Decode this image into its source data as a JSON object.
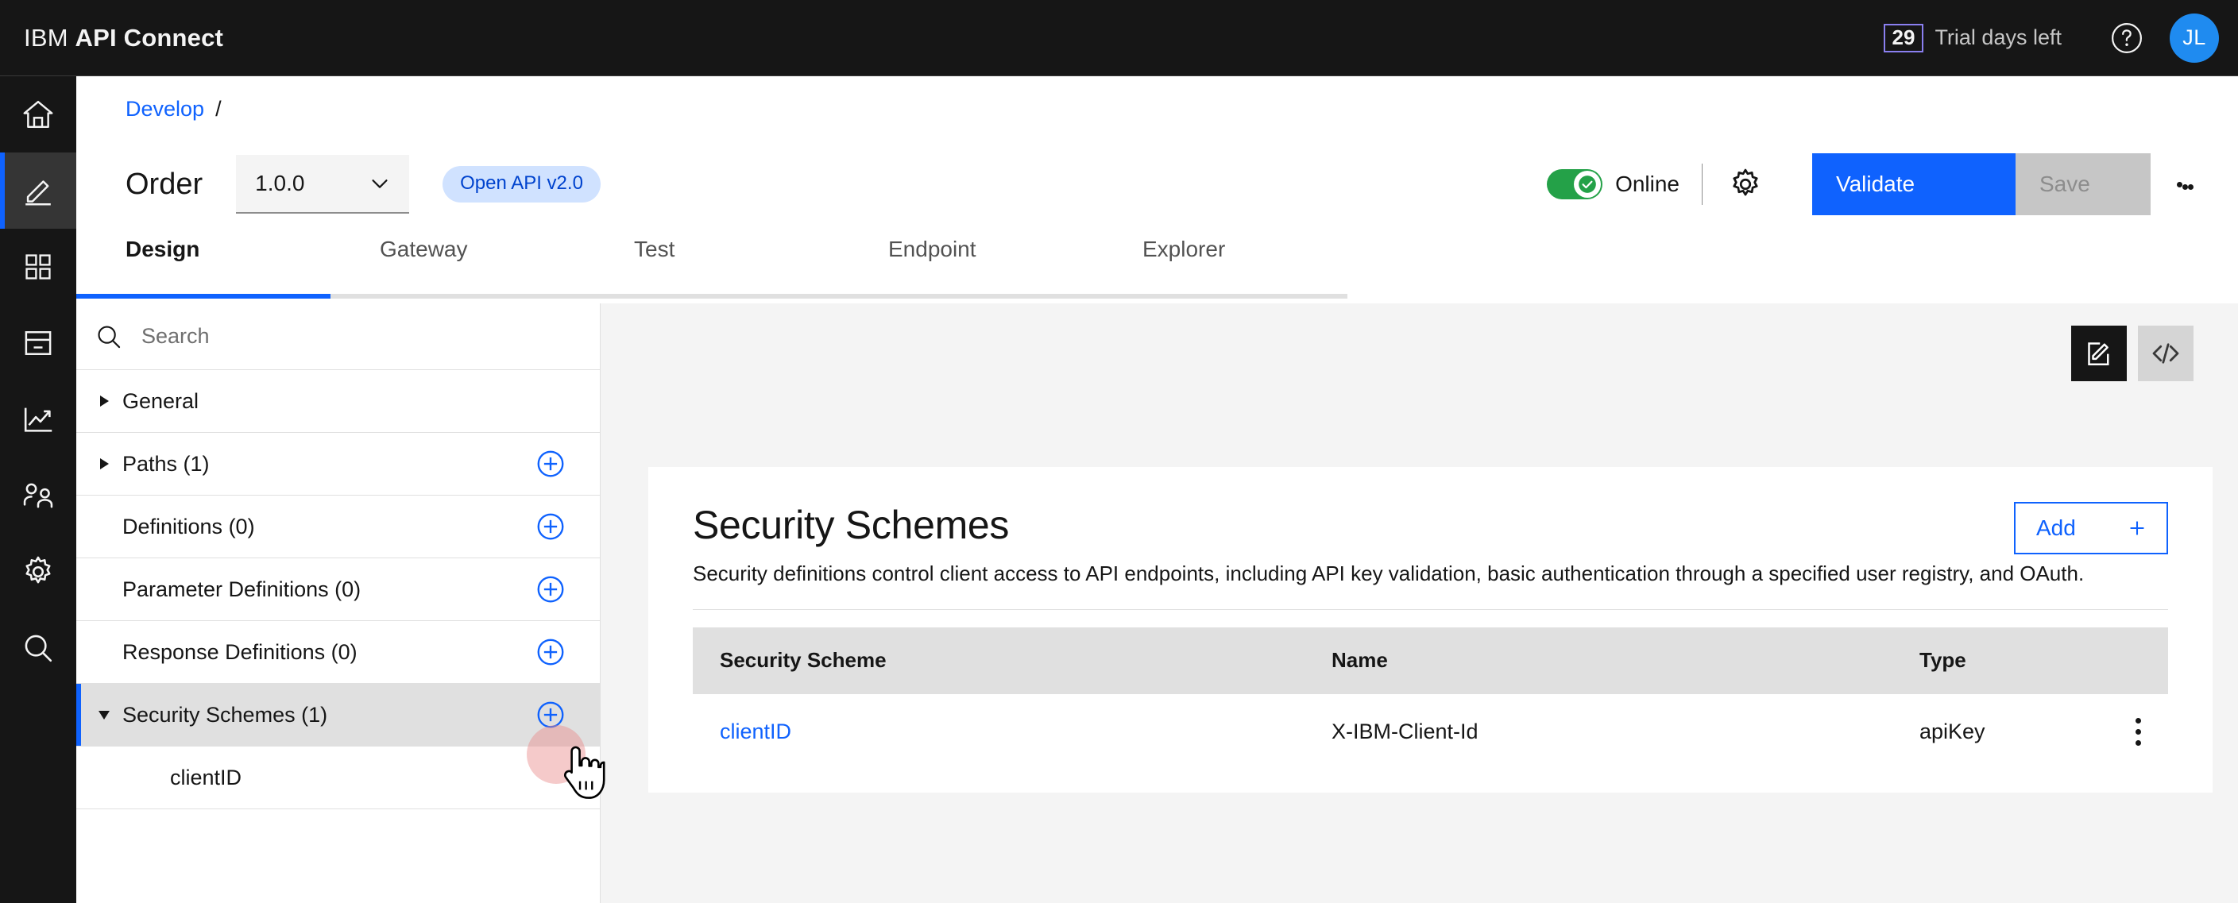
{
  "header": {
    "brand_prefix": "IBM",
    "brand_product": "API Connect",
    "trial_days": "29",
    "trial_label": "Trial days left",
    "help_icon": "help-circle-icon",
    "avatar_initials": "JL",
    "avatar_color": "#1f8bf0",
    "badge_border_color": "#8a7ff0",
    "background": "#161616"
  },
  "rail": {
    "items": [
      {
        "icon": "home-icon",
        "name": "home",
        "active": false
      },
      {
        "icon": "pencil-edit-icon",
        "name": "develop",
        "active": true
      },
      {
        "icon": "grid-apps-icon",
        "name": "manage",
        "active": false
      },
      {
        "icon": "catalog-icon",
        "name": "catalog",
        "active": false
      },
      {
        "icon": "analytics-chart-icon",
        "name": "analytics",
        "active": false
      },
      {
        "icon": "users-icon",
        "name": "members",
        "active": false
      },
      {
        "icon": "gear-icon",
        "name": "settings",
        "active": false
      },
      {
        "icon": "search-icon",
        "name": "search",
        "active": false
      }
    ],
    "active_indicator_color": "#0f62fe"
  },
  "breadcrumb": {
    "link": "Develop",
    "separator": "/"
  },
  "api_bar": {
    "name": "Order",
    "version_selected": "1.0.0",
    "version_caret_icon": "chevron-down-icon",
    "spec_tag": "Open API v2.0",
    "spec_tag_bg": "#d0e2ff",
    "spec_tag_color": "#0043ce",
    "online_label": "Online",
    "online_enabled": true,
    "toggle_color": "#24a148",
    "settings_icon": "gear-icon",
    "validate_label": "Validate",
    "validate_color": "#0f62fe",
    "save_label": "Save",
    "save_disabled": true,
    "overflow_icon": "kebab-menu-icon"
  },
  "tabs": [
    {
      "label": "Design",
      "active": true
    },
    {
      "label": "Gateway",
      "active": false
    },
    {
      "label": "Test",
      "active": false
    },
    {
      "label": "Endpoint",
      "active": false
    },
    {
      "label": "Explorer",
      "active": false
    }
  ],
  "tree": {
    "search_placeholder": "Search",
    "search_value": "",
    "search_icon": "search-icon",
    "rows": [
      {
        "label": "General",
        "caret": "right",
        "has_add": false,
        "selected": false,
        "child": false
      },
      {
        "label": "Paths (1)",
        "caret": "right",
        "has_add": true,
        "selected": false,
        "child": false
      },
      {
        "label": "Definitions (0)",
        "caret": "none",
        "has_add": true,
        "selected": false,
        "child": false
      },
      {
        "label": "Parameter Definitions (0)",
        "caret": "none",
        "has_add": true,
        "selected": false,
        "child": false
      },
      {
        "label": "Response Definitions (0)",
        "caret": "none",
        "has_add": true,
        "selected": false,
        "child": false
      },
      {
        "label": "Security Schemes (1)",
        "caret": "down",
        "has_add": true,
        "selected": true,
        "child": false
      },
      {
        "label": "clientID",
        "caret": "none",
        "has_add": false,
        "selected": false,
        "child": true
      }
    ]
  },
  "editor_toggles": [
    {
      "icon": "form-editor-icon",
      "active": true
    },
    {
      "icon": "code-source-icon",
      "active": false
    }
  ],
  "content": {
    "title": "Security Schemes",
    "description": "Security definitions control client access to API endpoints, including API key validation, basic authentication through a specified user registry, and OAuth.",
    "add_label": "Add",
    "add_plus_icon": "plus-icon",
    "add_color": "#0f62fe",
    "table": {
      "columns": [
        "Security Scheme",
        "Name",
        "Type"
      ],
      "rows": [
        {
          "scheme": "clientID",
          "name": "X-IBM-Client-Id",
          "type": "apiKey",
          "row_menu_icon": "kebab-menu-icon"
        }
      ]
    }
  },
  "cursor": {
    "type": "pointing-hand",
    "ripple_color": "#e88a8a"
  }
}
